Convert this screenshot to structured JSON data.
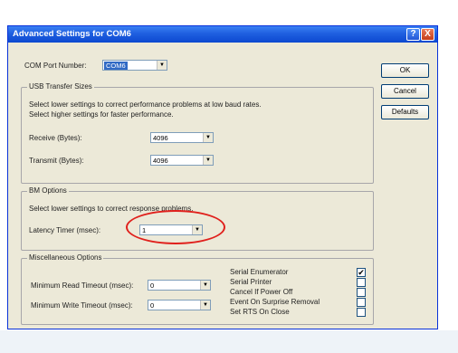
{
  "window": {
    "title": "Advanced Settings for COM6",
    "help_glyph": "?",
    "close_glyph": "X"
  },
  "com_port": {
    "label": "COM Port Number:",
    "value": "COM6"
  },
  "usb": {
    "group_title": "USB Transfer Sizes",
    "desc1": "Select lower settings to correct performance problems at low baud rates.",
    "desc2": "Select higher settings for faster performance.",
    "receive_label": "Receive (Bytes):",
    "receive_value": "4096",
    "transmit_label": "Transmit (Bytes):",
    "transmit_value": "4096"
  },
  "bm": {
    "group_title": "BM Options",
    "desc": "Select lower settings to correct response problems.",
    "latency_label": "Latency Timer (msec):",
    "latency_value": "1"
  },
  "misc": {
    "group_title": "Miscellaneous Options",
    "min_read_label": "Minimum Read Timeout (msec):",
    "min_read_value": "0",
    "min_write_label": "Minimum Write Timeout (msec):",
    "min_write_value": "0",
    "options": [
      {
        "label": "Serial Enumerator",
        "checked": true
      },
      {
        "label": "Serial Printer",
        "checked": false
      },
      {
        "label": "Cancel If Power Off",
        "checked": false
      },
      {
        "label": "Event On Surprise Removal",
        "checked": false
      },
      {
        "label": "Set RTS On Close",
        "checked": false
      }
    ]
  },
  "buttons": {
    "ok": "OK",
    "cancel": "Cancel",
    "defaults": "Defaults"
  },
  "glyphs": {
    "dropdown_arrow": "▼",
    "check": "✔"
  },
  "annotation": {
    "color": "#e0201c"
  }
}
